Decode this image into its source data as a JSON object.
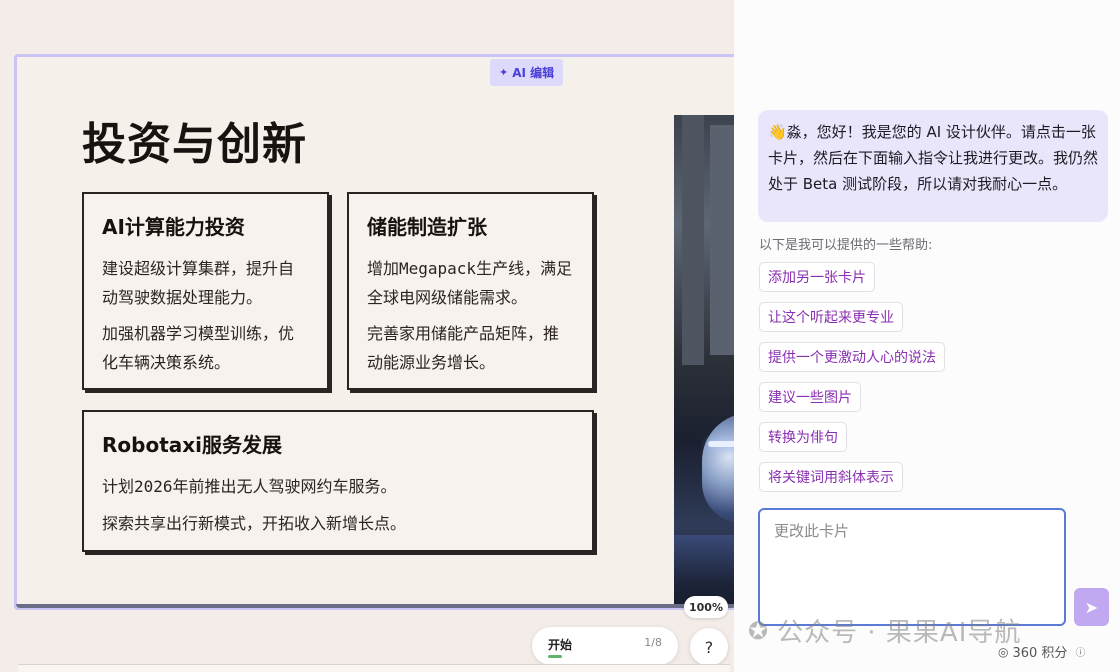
{
  "slide": {
    "ai_edit_label": "AI 编辑",
    "title": "投资与创新",
    "cards": [
      {
        "heading": "AI计算能力投资",
        "lines": [
          "建设超级计算集群，提升自动驾驶数据处理能力。",
          "加强机器学习模型训练，优化车辆决策系统。"
        ]
      },
      {
        "heading": "储能制造扩张",
        "lines": [
          "增加Megapack生产线，满足全球电网级储能需求。",
          "完善家用储能产品矩阵，推动能源业务增长。"
        ]
      },
      {
        "heading": "Robotaxi服务发展",
        "lines": [
          "计划2026年前推出无人驾驶网约车服务。",
          "探索共享出行新模式，开拓收入新增长点。"
        ]
      }
    ]
  },
  "controls": {
    "zoom": "100%",
    "start_label": "开始",
    "page_count": "1/8",
    "help": "?"
  },
  "panel": {
    "greeting": "👋淼，您好！我是您的 AI 设计伙伴。请点击一张卡片，然后在下面输入指令让我进行更改。我仍然处于 Beta 测试阶段，所以请对我耐心一点。",
    "help_label": "以下是我可以提供的一些帮助:",
    "suggestions": [
      "添加另一张卡片",
      "让这个听起来更专业",
      "提供一个更激动人心的说法",
      "建议一些图片",
      "转换为俳句",
      "将关键词用斜体表示"
    ],
    "input_placeholder": "更改此卡片",
    "points": "360 积分"
  },
  "watermark": "公众号 · 果果AI导航",
  "icons": {
    "ai_edit": "sparkle-icon",
    "send": "send-arrow-icon",
    "points": "coin-icon",
    "info": "info-icon",
    "watermark": "wechat-icon"
  },
  "colors": {
    "accent_purple": "#8a2fb1",
    "slide_border": "#c9c4f4",
    "greet_bg": "#e9e6fb",
    "input_border": "#5a7ad6",
    "send_bg": "#c0a9f0"
  }
}
